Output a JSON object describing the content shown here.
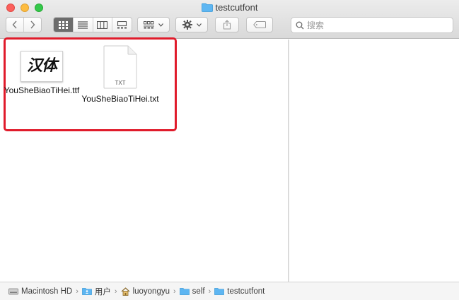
{
  "window": {
    "title": "testcutfont"
  },
  "toolbar": {
    "back_icon": "chevron-left-icon",
    "forward_icon": "chevron-right-icon",
    "view_modes": [
      "icon-view",
      "list-view",
      "column-view",
      "gallery-view"
    ],
    "active_view": "icon-view",
    "group_icon": "group-icon",
    "action_icon": "gear-icon",
    "share_icon": "share-icon",
    "tag_icon": "tag-icon"
  },
  "search": {
    "placeholder": "搜索"
  },
  "files": [
    {
      "name": "YouSheBiaoTiHei.ttf",
      "thumb_text": "汉体",
      "kind": "font"
    },
    {
      "name": "YouSheBiaoTiHei.txt",
      "thumb_text": "TXT",
      "kind": "text"
    }
  ],
  "pathbar": {
    "items": [
      "Macintosh HD",
      "用户",
      "luoyongyu",
      "self",
      "testcutfont"
    ]
  },
  "colors": {
    "selection_outline": "#e01b2b",
    "folder_blue": "#5eb6f2"
  }
}
